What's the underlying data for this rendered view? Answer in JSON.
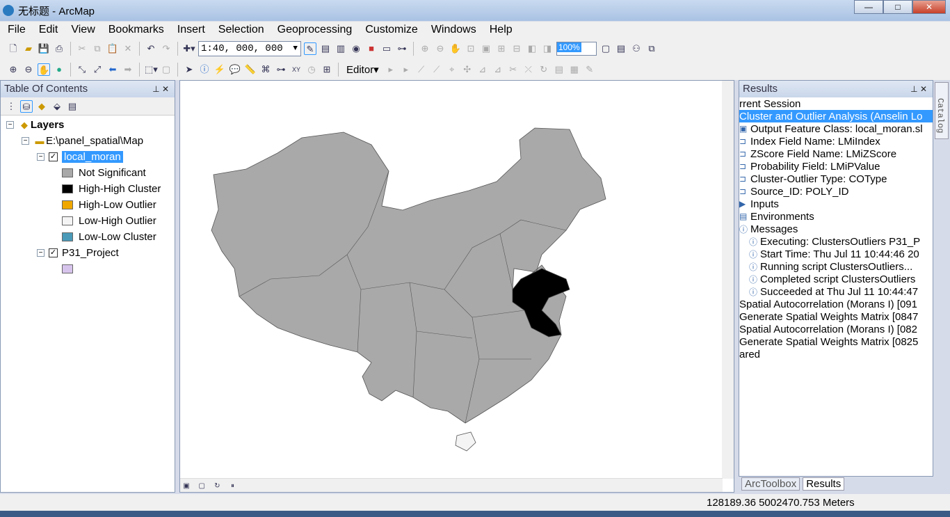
{
  "window": {
    "title": "无标题 - ArcMap",
    "minimize": "—",
    "maximize": "□",
    "close": "✕"
  },
  "menu": [
    "File",
    "Edit",
    "View",
    "Bookmarks",
    "Insert",
    "Selection",
    "Geoprocessing",
    "Customize",
    "Windows",
    "Help"
  ],
  "toolbar": {
    "scale": "1:40, 000, 000",
    "zoom_level": "100%",
    "editor": "Editor▾"
  },
  "toc": {
    "title": "Table Of Contents",
    "root": "Layers",
    "folder": "E:\\panel_spatial\\Map",
    "layers": [
      {
        "name": "local_moran",
        "classes": [
          {
            "label": "Not Significant",
            "color": "#a9a9a9"
          },
          {
            "label": "High-High Cluster",
            "color": "#000000"
          },
          {
            "label": "High-Low Outlier",
            "color": "#f0a800"
          },
          {
            "label": "Low-High Outlier",
            "color": "#f4f4f4"
          },
          {
            "label": "Low-Low Cluster",
            "color": "#4a9ab8"
          }
        ]
      },
      {
        "name": "P31_Project",
        "classes": [
          {
            "label": "",
            "color": "#d7c4ec"
          }
        ]
      }
    ]
  },
  "results": {
    "title": "Results",
    "items": [
      {
        "text": "rrent Session",
        "indent": 0
      },
      {
        "text": "Cluster and Outlier Analysis (Anselin Lo",
        "indent": 0,
        "selected": true
      },
      {
        "text": "Output Feature Class: local_moran.sl",
        "indent": 1,
        "icon": "▣"
      },
      {
        "text": "Index Field Name: LMiIndex",
        "indent": 1,
        "icon": "⊐"
      },
      {
        "text": "ZScore Field Name: LMiZScore",
        "indent": 1,
        "icon": "⊐"
      },
      {
        "text": "Probability Field: LMiPValue",
        "indent": 1,
        "icon": "⊐"
      },
      {
        "text": "Cluster-Outlier Type: COType",
        "indent": 1,
        "icon": "⊐"
      },
      {
        "text": "Source_ID: POLY_ID",
        "indent": 1,
        "icon": "⊐"
      },
      {
        "text": "Inputs",
        "indent": 1,
        "icon": "▶"
      },
      {
        "text": "Environments",
        "indent": 1,
        "icon": "▤"
      },
      {
        "text": "Messages",
        "indent": 1,
        "icon": "ⓘ"
      },
      {
        "text": "Executing: ClustersOutliers P31_P",
        "indent": 2,
        "icon": "ⓘ"
      },
      {
        "text": "Start Time: Thu Jul 11 10:44:46 20",
        "indent": 2,
        "icon": "ⓘ"
      },
      {
        "text": "Running script ClustersOutliers...",
        "indent": 2,
        "icon": "ⓘ"
      },
      {
        "text": "Completed script ClustersOutliers",
        "indent": 2,
        "icon": "ⓘ"
      },
      {
        "text": "Succeeded at Thu Jul 11 10:44:47",
        "indent": 2,
        "icon": "ⓘ"
      },
      {
        "text": "Spatial Autocorrelation (Morans I) [091",
        "indent": 0
      },
      {
        "text": "Generate Spatial Weights Matrix [0847",
        "indent": 0
      },
      {
        "text": "Spatial Autocorrelation (Morans I) [082",
        "indent": 0
      },
      {
        "text": "Generate Spatial Weights Matrix [0825",
        "indent": 0
      },
      {
        "text": "ared",
        "indent": 0
      }
    ],
    "tabs": [
      "ArcToolbox",
      "Results"
    ],
    "catalog": "Catalog"
  },
  "status": {
    "coords": "128189.36  5002470.753 Meters"
  }
}
